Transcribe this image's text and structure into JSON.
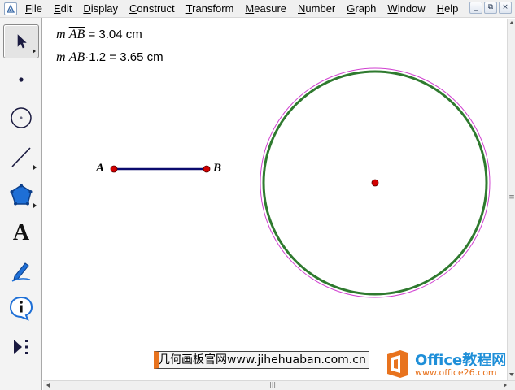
{
  "menubar": {
    "items": [
      {
        "accel": "F",
        "rest": "ile"
      },
      {
        "accel": "E",
        "rest": "dit"
      },
      {
        "accel": "D",
        "rest": "isplay"
      },
      {
        "accel": "C",
        "rest": "onstruct"
      },
      {
        "accel": "T",
        "rest": "ransform"
      },
      {
        "accel": "M",
        "rest": "easure"
      },
      {
        "accel": "N",
        "rest": "umber"
      },
      {
        "accel": "G",
        "rest": "raph"
      },
      {
        "accel": "W",
        "rest": "indow"
      },
      {
        "accel": "H",
        "rest": "elp"
      }
    ],
    "window_controls": {
      "minimize": "_",
      "restore": "⧉",
      "close": "×"
    }
  },
  "toolbox": {
    "tools": [
      {
        "name": "arrow-tool",
        "icon": "arrow-icon",
        "active": true
      },
      {
        "name": "point-tool",
        "icon": "point-icon"
      },
      {
        "name": "compass-tool",
        "icon": "circle-icon"
      },
      {
        "name": "straightedge-tool",
        "icon": "line-icon"
      },
      {
        "name": "polygon-tool",
        "icon": "polygon-icon"
      },
      {
        "name": "text-tool",
        "icon": "text-icon",
        "glyph": "A"
      },
      {
        "name": "marker-tool",
        "icon": "marker-pen-icon"
      },
      {
        "name": "information-tool",
        "icon": "info-icon",
        "glyph": "i"
      },
      {
        "name": "custom-tool",
        "icon": "custom-tool-icon"
      }
    ]
  },
  "sketch": {
    "measurements": [
      {
        "prefix": "m",
        "segment": "AB",
        "suffix": " = 3.04 cm"
      },
      {
        "prefix": "m",
        "segment": "AB",
        "suffix": "·1.2 = 3.65 cm"
      }
    ],
    "point_a_label": "A",
    "point_b_label": "B",
    "colors": {
      "segment": "#0a0a6e",
      "point_fill": "#d20000",
      "circle_inner": "#2f7a2f",
      "circle_outer": "#d040d0"
    }
  },
  "watermark": {
    "left_text": "几何画板官网www.jihehuaban.com.cn",
    "brand": "Office教程网",
    "url": "www.office26.com",
    "accent": "#e8731e",
    "brand_color": "#1f8fd8"
  },
  "scrollbars": {
    "vertical_grip": "≡",
    "horizontal_grip": "|||"
  }
}
